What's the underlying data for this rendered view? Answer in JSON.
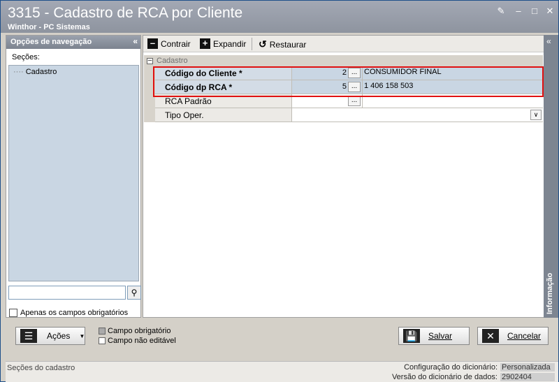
{
  "window": {
    "title": "3315 - Cadastro de RCA por Cliente",
    "subtitle": "Winthor - PC Sistemas"
  },
  "left_panel": {
    "header": "Opções de navegação",
    "sections_label": "Seções:",
    "tree_items": [
      "Cadastro"
    ],
    "required_only_label": "Apenas os campos obrigatórios"
  },
  "toolbar": {
    "collapse_label": "Contrair",
    "expand_label": "Expandir",
    "restore_label": "Restaurar"
  },
  "grid": {
    "category": "Cadastro",
    "rows": [
      {
        "label": "Código do Cliente *",
        "value": "2",
        "ellipsis": "...",
        "description": "CONSUMIDOR FINAL"
      },
      {
        "label": "Código dp RCA *",
        "value": "5",
        "ellipsis": "...",
        "description": "1 406 158 503"
      },
      {
        "label": "RCA Padrão",
        "value": "",
        "ellipsis": "...",
        "description": ""
      },
      {
        "label": "Tipo Oper.",
        "value": "",
        "ellipsis": "",
        "description": ""
      }
    ]
  },
  "info_panel": {
    "label": "Informação"
  },
  "bottom": {
    "actions_label": "Ações",
    "legend_required": "Campo obrigatório",
    "legend_readonly": "Campo não editável",
    "save_label": "Salvar",
    "cancel_label": "Cancelar"
  },
  "status": {
    "left": "Seções do cadastro",
    "dict_config_label": "Configuração do dicionário:",
    "dict_config_value": "Personalizada",
    "dict_version_label": "Versão do dicionário de dados:",
    "dict_version_value": "2902404"
  },
  "colors": {
    "highlight_border": "#e01010",
    "required_row_bg": "#c9d6e3",
    "title_bar": "#8e949f"
  }
}
